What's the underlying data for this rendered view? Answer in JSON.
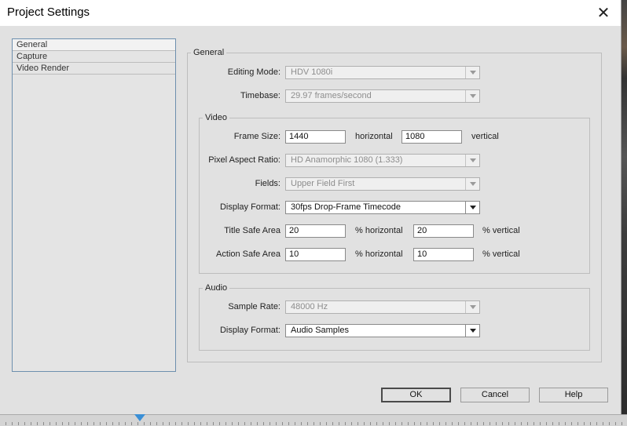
{
  "window": {
    "title": "Project Settings",
    "close_glyph": "✕"
  },
  "sidebar": {
    "items": [
      {
        "label": "General",
        "selected": true
      },
      {
        "label": "Capture",
        "selected": false
      },
      {
        "label": "Video Render",
        "selected": false
      }
    ]
  },
  "general": {
    "group_label": "General",
    "editing_mode": {
      "label": "Editing Mode:",
      "value": "HDV 1080i"
    },
    "timebase": {
      "label": "Timebase:",
      "value": "29.97 frames/second"
    }
  },
  "video": {
    "group_label": "Video",
    "frame_size": {
      "label": "Frame Size:",
      "horizontal": "1440",
      "horizontal_unit": "horizontal",
      "vertical": "1080",
      "vertical_unit": "vertical"
    },
    "pixel_aspect": {
      "label": "Pixel Aspect Ratio:",
      "value": "HD Anamorphic 1080 (1.333)"
    },
    "fields": {
      "label": "Fields:",
      "value": "Upper Field First"
    },
    "display_format": {
      "label": "Display Format:",
      "value": "30fps Drop-Frame Timecode"
    },
    "title_safe": {
      "label": "Title Safe Area",
      "horizontal": "20",
      "horizontal_unit": "% horizontal",
      "vertical": "20",
      "vertical_unit": "% vertical"
    },
    "action_safe": {
      "label": "Action Safe Area",
      "horizontal": "10",
      "horizontal_unit": "% horizontal",
      "vertical": "10",
      "vertical_unit": "% vertical"
    }
  },
  "audio": {
    "group_label": "Audio",
    "sample_rate": {
      "label": "Sample Rate:",
      "value": "48000 Hz"
    },
    "display_format": {
      "label": "Display Format:",
      "value": "Audio Samples"
    }
  },
  "buttons": {
    "ok": "OK",
    "cancel": "Cancel",
    "help": "Help"
  },
  "colors": {
    "accent": "#3a8fd6",
    "sidebar_border": "#6d8fae"
  }
}
